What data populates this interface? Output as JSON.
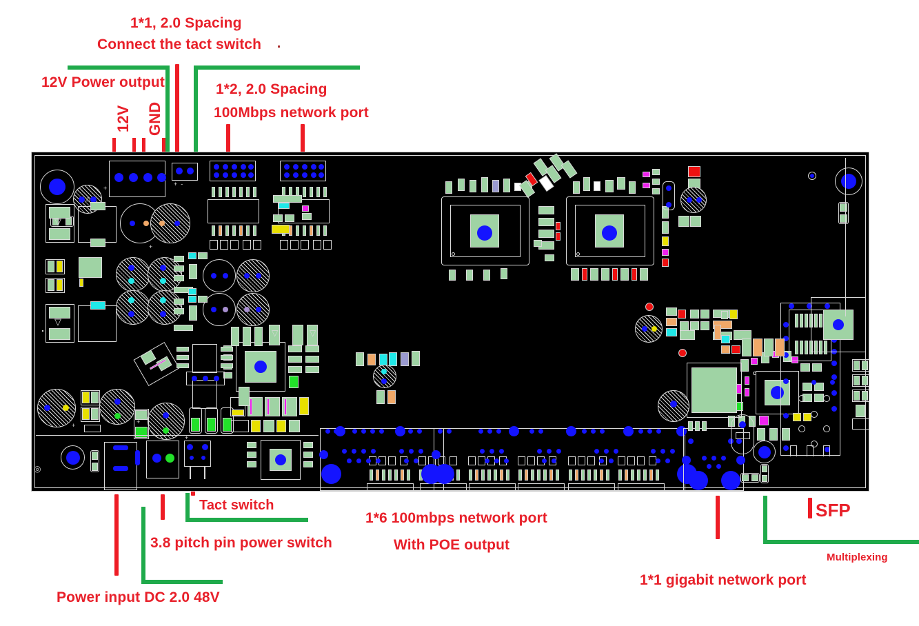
{
  "diagram": {
    "title": "Annotated PCB layout - 6-port 100Mbps PoE switch board",
    "colors": {
      "annotation_text": "#e8202a",
      "red_leader": "#ee1c25",
      "green_leader": "#1faa4b",
      "board_background": "#000000",
      "silkscreen": "#d8d8d8",
      "pad": "#1414ff"
    }
  },
  "annotations": {
    "top": [
      {
        "id": "tact-header",
        "line1": "1*1, 2.0 Spacing",
        "line2": "Connect the tact switch"
      },
      {
        "id": "power-output",
        "line1": "12V Power output"
      },
      {
        "id": "pin-12v",
        "line1": "12V"
      },
      {
        "id": "pin-gnd",
        "line1": "GND"
      },
      {
        "id": "net-port-header",
        "line1": "1*2, 2.0 Spacing",
        "line2": "100Mbps network port"
      }
    ],
    "bottom": [
      {
        "id": "tact-switch",
        "line1": "Tact switch"
      },
      {
        "id": "pitch-pin-switch",
        "line1": "3.8 pitch pin power switch"
      },
      {
        "id": "power-input",
        "line1": "Power input DC 2.0 48V"
      },
      {
        "id": "poe-ports",
        "line1": "1*6 100mbps network port",
        "line2": "With POE output"
      },
      {
        "id": "gigabit-port",
        "line1": "1*1 gigabit network port"
      },
      {
        "id": "sfp",
        "line1": "SFP"
      },
      {
        "id": "multiplexing",
        "line1": "Multiplexing"
      }
    ]
  }
}
